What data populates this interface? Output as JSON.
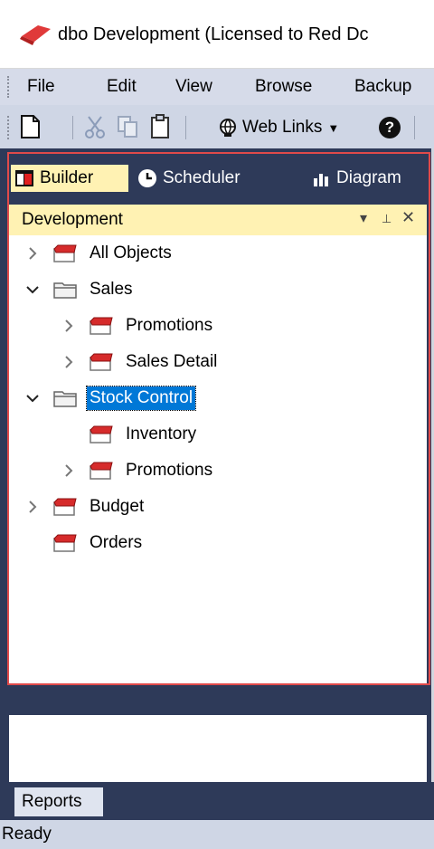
{
  "window": {
    "title": "dbo  Development  (Licensed to Red Dc"
  },
  "menu": {
    "items": [
      "File",
      "Edit",
      "View",
      "Browse",
      "Backup"
    ]
  },
  "toolbar": {
    "web_links_label": "Web Links",
    "help_label": "?"
  },
  "tabs": [
    {
      "label": "Builder",
      "icon": "builder-icon",
      "active": true
    },
    {
      "label": "Scheduler",
      "icon": "clock-icon",
      "active": false
    },
    {
      "label": "Diagram",
      "icon": "bar-chart-icon",
      "active": false
    }
  ],
  "panel": {
    "title": "Development",
    "dropdown_glyph": "▾",
    "pin_glyph": "⊥",
    "close_glyph": "✕"
  },
  "tree": {
    "nodes": [
      {
        "label": "All Objects",
        "expander": "collapsed",
        "folder": "red",
        "level": 0
      },
      {
        "label": "Sales",
        "expander": "expanded",
        "folder": "open",
        "level": 0
      },
      {
        "label": "Promotions",
        "expander": "collapsed",
        "folder": "red",
        "level": 1
      },
      {
        "label": "Sales Detail",
        "expander": "collapsed",
        "folder": "red",
        "level": 1
      },
      {
        "label": "Stock Control",
        "expander": "expanded",
        "folder": "open",
        "level": 0,
        "selected": true
      },
      {
        "label": "Inventory",
        "expander": "none",
        "folder": "red",
        "level": 1
      },
      {
        "label": "Promotions",
        "expander": "collapsed",
        "folder": "red",
        "level": 1
      },
      {
        "label": "Budget",
        "expander": "collapsed",
        "folder": "red",
        "level": 0
      },
      {
        "label": "Orders",
        "expander": "none",
        "folder": "red",
        "level": 0
      }
    ]
  },
  "bottom_tabs": {
    "reports_label": "Reports"
  },
  "status": {
    "text": "Ready"
  },
  "colors": {
    "selection": "#0078d7",
    "panel_header": "#fff2b3",
    "dark_background": "#2e3a59",
    "highlight_border": "#e04a4a"
  }
}
